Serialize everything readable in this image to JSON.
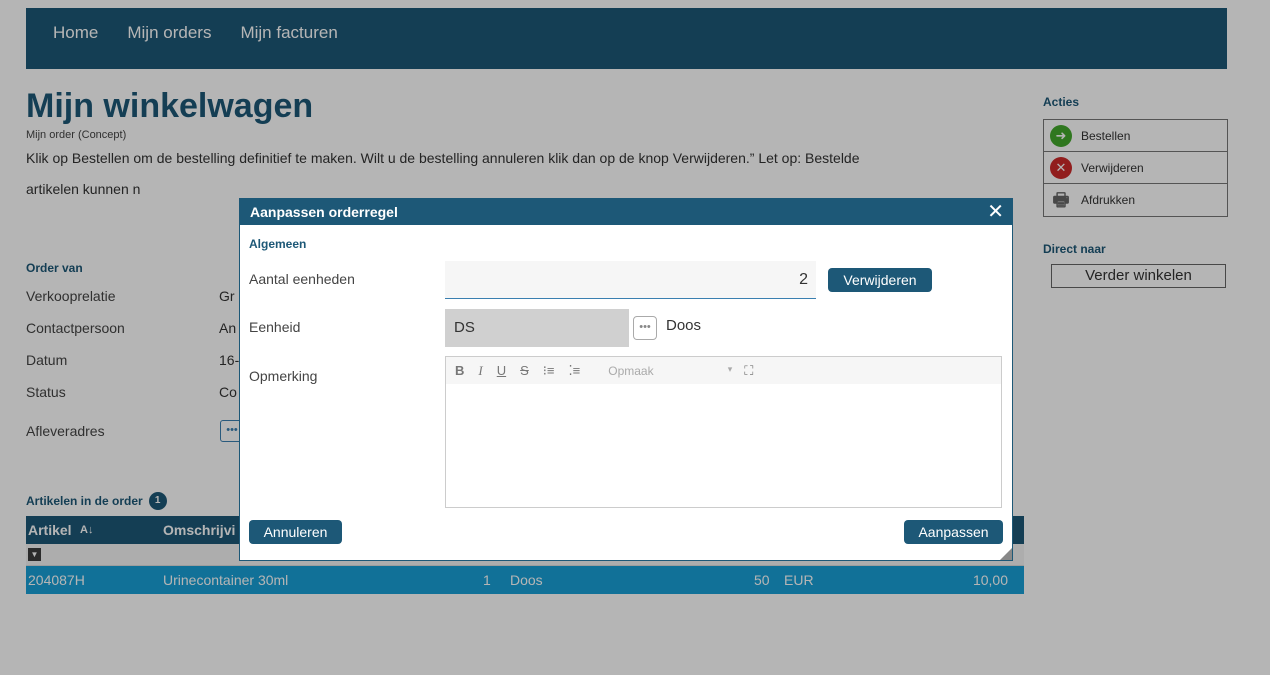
{
  "nav": {
    "items": [
      "Home",
      "Mijn orders",
      "Mijn facturen"
    ]
  },
  "page": {
    "title": "Mijn winkelwagen",
    "subtitle": "Mijn order (Concept)",
    "intro": "Klik op Bestellen om de bestelling definitief te maken. Wilt u de bestelling annuleren klik dan op de knop Verwijderen.” Let op: Bestelde artikelen kunnen n"
  },
  "order": {
    "heading": "Order van",
    "fields": [
      {
        "label": "Verkooprelatie",
        "value": "Gr"
      },
      {
        "label": "Contactpersoon",
        "value": "An"
      },
      {
        "label": "Datum",
        "value": "16-"
      },
      {
        "label": "Status",
        "value": "Co"
      },
      {
        "label": "Afleveradres",
        "value": ""
      }
    ],
    "address_button": "•••"
  },
  "articles": {
    "heading": "Artikelen in de order",
    "count": "1",
    "columns": [
      "Artikel",
      "Omschrijvi"
    ],
    "sort_icon": "sort-alpha-icon",
    "rows": [
      {
        "code": "204087H",
        "description": "Urinecontainer 30ml",
        "qty": "1",
        "unit": "Doos",
        "price": "50",
        "currency": "EUR",
        "total": "10,00"
      }
    ]
  },
  "sidebar": {
    "acties_heading": "Acties",
    "actions": [
      {
        "label": "Bestellen",
        "icon": "arrow-right-icon"
      },
      {
        "label": "Verwijderen",
        "icon": "x-circle-icon"
      },
      {
        "label": "Afdrukken",
        "icon": "printer-icon"
      }
    ],
    "direct_heading": "Direct naar",
    "verder_label": "Verder winkelen"
  },
  "modal": {
    "title": "Aanpassen orderregel",
    "section": "Algemeen",
    "qty_label": "Aantal eenheden",
    "qty_value": "2",
    "remove_label": "Verwijderen",
    "unit_label": "Eenheid",
    "unit_code": "DS",
    "unit_name": "Doos",
    "unit_picker": "•••",
    "remark_label": "Opmerking",
    "toolbar": [
      "B",
      "I",
      "U",
      "S"
    ],
    "format_placeholder": "Opmaak",
    "cancel_label": "Annuleren",
    "submit_label": "Aanpassen"
  },
  "colors": {
    "brand": "#1d5877",
    "row_highlight": "#18a0d6",
    "success": "#43a82c",
    "danger": "#cc2a2a"
  }
}
